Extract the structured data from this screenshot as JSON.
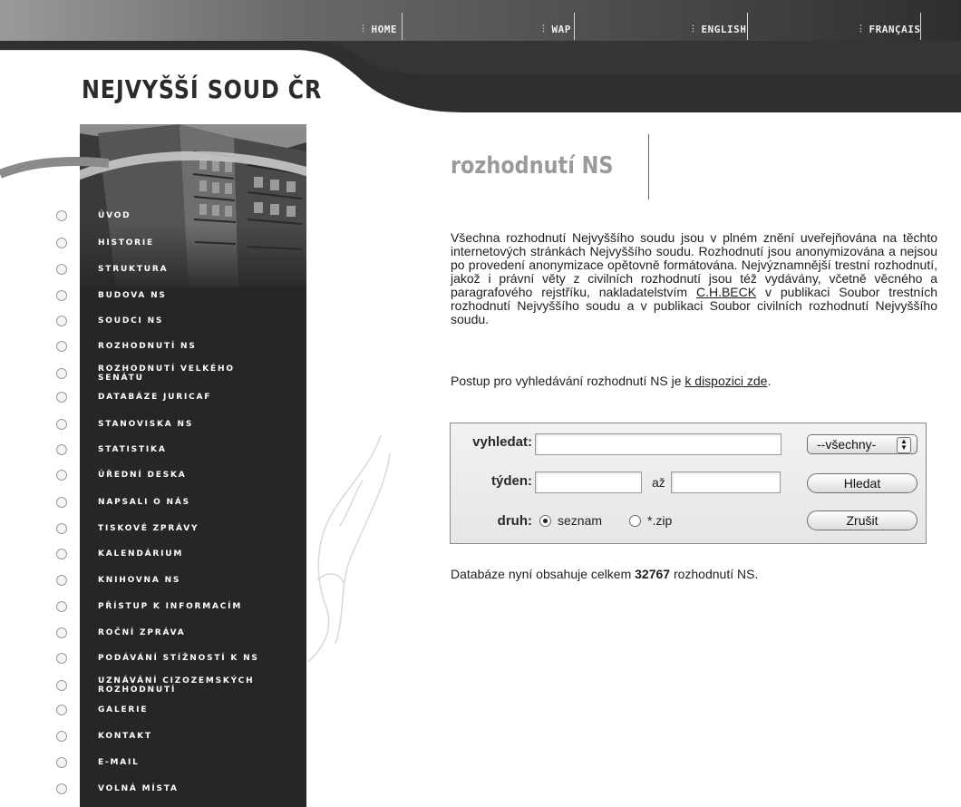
{
  "nav": {
    "items": [
      {
        "label": "HOME"
      },
      {
        "label": "WAP"
      },
      {
        "label": "ENGLISH"
      },
      {
        "label": "FRANÇAIS"
      }
    ]
  },
  "header": {
    "site_title": "NEJVYŠŠÍ SOUD ČR"
  },
  "sidebar": {
    "items": [
      {
        "label": "ÚVOD"
      },
      {
        "label": "HISTORIE"
      },
      {
        "label": "STRUKTURA"
      },
      {
        "label": "BUDOVA NS"
      },
      {
        "label": "SOUDCI NS"
      },
      {
        "label": "ROZHODNUTÍ NS"
      },
      {
        "label": "ROZHODNUTÍ VELKÉHO SENÁTU"
      },
      {
        "label": "DATABÁZE JURICAF"
      },
      {
        "label": "STANOVISKA NS"
      },
      {
        "label": "STATISTIKA"
      },
      {
        "label": "ÚŘEDNÍ DESKA"
      },
      {
        "label": "NAPSALI O NÁS"
      },
      {
        "label": "TISKOVÉ ZPRÁVY"
      },
      {
        "label": "KALENDÁRIUM"
      },
      {
        "label": "KNIHOVNA NS"
      },
      {
        "label": "PŘÍSTUP K INFORMACÍM"
      },
      {
        "label": "ROČNÍ ZPRÁVA"
      },
      {
        "label": "PODÁVÁNÍ STÍŽNOSTÍ K NS"
      },
      {
        "label": "UZNÁVÁNÍ CIZOZEMSKÝCH ROZHODNUTÍ"
      },
      {
        "label": "GALERIE"
      },
      {
        "label": "KONTAKT"
      },
      {
        "label": "E-MAIL"
      },
      {
        "label": "VOLNÁ MÍSTA"
      }
    ]
  },
  "main": {
    "title": "rozhodnutí NS",
    "intro_before_link": "Všechna rozhodnutí Nejvyššího soudu jsou v plném znění uveřejňována na těchto internetových stránkách Nejvyššího soudu. Rozhodnutí jsou anonymizována a nejsou po provedení anonymizace opětovně formátována. Nejvýznamnější trestní rozhodnutí, jakož i právní věty z civilních rozhodnutí jsou též vydávány, včetně věcného a paragrafového rejstříku, nakladatelstvím ",
    "intro_link": "C.H.BECK",
    "intro_after_link": " v publikaci Soubor trestních rozhodnutí Nejvyššího soudu a v publikaci Soubor civilních rozhodnutí Nejvyššího soudu.",
    "postup_text": "Postup pro vyhledávání rozhodnutí NS je ",
    "postup_link": "k dispozici zde",
    "postup_end": ".",
    "db_before": "Databáze nyní obsahuje celkem ",
    "db_count": "32767",
    "db_after": " rozhodnutí NS."
  },
  "search": {
    "search_label": "vyhledat:",
    "search_value": "",
    "select_value": "--všechny-",
    "week_label": "týden:",
    "week_from_value": "",
    "until_label": "až",
    "week_to_value": "",
    "search_button": "Hledat",
    "type_label": "druh:",
    "radio_list_label": "seznam",
    "radio_zip_label": "*.zip",
    "selected_type": "seznam",
    "cancel_button": "Zrušit"
  },
  "colors": {
    "topbar": "#5a5a5a",
    "panel": "#262626",
    "title_gray": "#9a9a9a"
  }
}
